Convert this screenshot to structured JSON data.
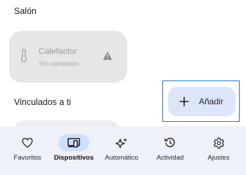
{
  "sections": {
    "salon": "Salón",
    "linked": "Vinculados a ti"
  },
  "device": {
    "name": "Calefactor",
    "status": "Sin conexión",
    "icon": "thermometer-icon",
    "warning_icon": "warning-icon"
  },
  "fab": {
    "label": "Añadir",
    "icon": "plus-icon"
  },
  "nav": {
    "items": [
      {
        "label": "Favoritos",
        "icon": "heart-icon",
        "active": false
      },
      {
        "label": "Dispositivos",
        "icon": "devices-icon",
        "active": true
      },
      {
        "label": "Automático",
        "icon": "sparkle-icon",
        "active": false
      },
      {
        "label": "Actividad",
        "icon": "history-icon",
        "active": false
      },
      {
        "label": "Ajustes",
        "icon": "gear-icon",
        "active": false
      }
    ]
  },
  "colors": {
    "accent": "#1f7bd6",
    "fab_bg": "#dce6fb",
    "nav_bg": "#eef1f8",
    "active_pill": "#cbe0fb",
    "card_bg": "#e6e6e8"
  }
}
